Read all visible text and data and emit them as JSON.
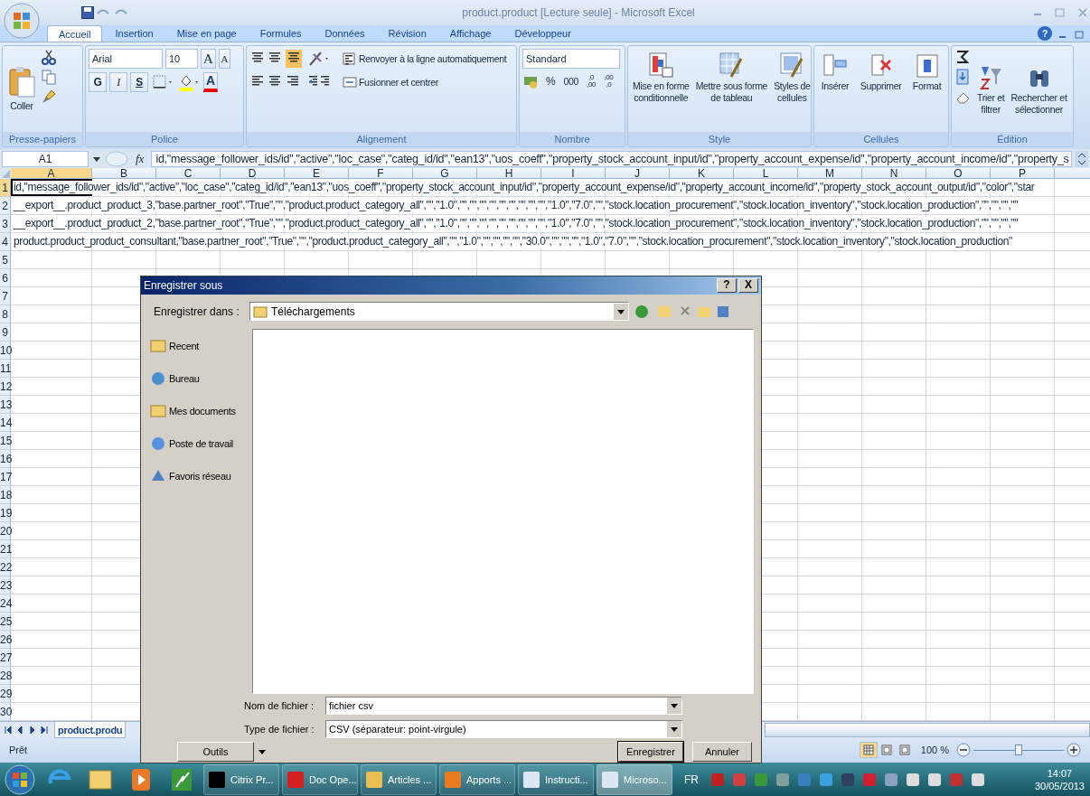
{
  "window": {
    "title": "product.product  [Lecture seule] - Microsoft Excel"
  },
  "ribbon_tabs": [
    {
      "label": "Accueil",
      "selected": true
    },
    {
      "label": "Insertion",
      "selected": false
    },
    {
      "label": "Mise en page",
      "selected": false
    },
    {
      "label": "Formules",
      "selected": false
    },
    {
      "label": "Données",
      "selected": false
    },
    {
      "label": "Révision",
      "selected": false
    },
    {
      "label": "Affichage",
      "selected": false
    },
    {
      "label": "Développeur",
      "selected": false
    }
  ],
  "ribbon": {
    "help": "?",
    "paste": "Coller",
    "font_name": "Arial",
    "font_size": "10",
    "grow": "A",
    "shrink": "A",
    "bold": "G",
    "italic": "I",
    "underline": "S",
    "font_color": "A",
    "wrap": "Renvoyer à la ligne automatiquement",
    "merge": "Fusionner et centrer",
    "number_format": "Standard",
    "percent": "%",
    "thousands": "000",
    "decimals": [
      {
        "top": ",0",
        "bottom": ",00"
      },
      {
        "top": ",00",
        "bottom": ",0"
      }
    ],
    "style_buttons": [
      {
        "lines": [
          "Mise en forme",
          "conditionnelle"
        ]
      },
      {
        "lines": [
          "Mettre sous forme",
          "de tableau"
        ]
      },
      {
        "lines": [
          "Styles de",
          "cellules"
        ]
      }
    ],
    "cell_buttons": [
      {
        "lines": [
          "Insérer"
        ]
      },
      {
        "lines": [
          "Supprimer"
        ]
      },
      {
        "lines": [
          "Format"
        ]
      }
    ],
    "edit_buttons": [
      {
        "lines": [
          "Trier et",
          "filtrer"
        ]
      },
      {
        "lines": [
          "Rechercher et",
          "sélectionner"
        ]
      }
    ],
    "groups": [
      "Presse-papiers",
      "Police",
      "Alignement",
      "Nombre",
      "Style",
      "Cellules",
      "Édition"
    ]
  },
  "formula_bar": {
    "name_box": "A1",
    "fx": "fx",
    "formula": "id,\"message_follower_ids/id\",\"active\",\"loc_case\",\"categ_id/id\",\"ean13\",\"uos_coeff\",\"property_stock_account_input/id\",\"property_account_expense/id\",\"property_account_income/id\",\"property_s"
  },
  "columns": [
    {
      "label": "A",
      "selected": true
    },
    {
      "label": "B",
      "selected": false
    },
    {
      "label": "C",
      "selected": false
    },
    {
      "label": "D",
      "selected": false
    },
    {
      "label": "E",
      "selected": false
    },
    {
      "label": "F",
      "selected": false
    },
    {
      "label": "G",
      "selected": false
    },
    {
      "label": "H",
      "selected": false
    },
    {
      "label": "I",
      "selected": false
    },
    {
      "label": "J",
      "selected": false
    },
    {
      "label": "K",
      "selected": false
    },
    {
      "label": "L",
      "selected": false
    },
    {
      "label": "M",
      "selected": false
    },
    {
      "label": "N",
      "selected": false
    },
    {
      "label": "O",
      "selected": false
    },
    {
      "label": "P",
      "selected": false
    }
  ],
  "rows": [
    {
      "number": "1",
      "selected": true,
      "text": "id,\"message_follower_ids/id\",\"active\",\"loc_case\",\"categ_id/id\",\"ean13\",\"uos_coeff\",\"property_stock_account_input/id\",\"property_account_expense/id\",\"property_account_income/id\",\"property_stock_account_output/id\",\"color\",\"star"
    },
    {
      "number": "2",
      "selected": false,
      "text": "__export__.product_product_3,\"base.partner_root\",\"True\",\"\",\"product.product_category_all\",\"\",\"1.0\",\"\",\"\",\"\",\"\",\"\",\"\",\"\",\"\",\"\",\"1.0\",\"7.0\",\"\",\"stock.location_procurement\",\"stock.location_inventory\",\"stock.location_production\",\"\",\"\",\"\",\"\""
    },
    {
      "number": "3",
      "selected": false,
      "text": "__export__.product_product_2,\"base.partner_root\",\"True\",\"\",\"product.product_category_all\",\"\",\"1.0\",\"\",\"\",\"\",\"\",\"\",\"\",\"\",\"\",\"\",\"1.0\",\"7.0\",\"\",\"stock.location_procurement\",\"stock.location_inventory\",\"stock.location_production\",\"\",\"\",\"\",\"\""
    },
    {
      "number": "4",
      "selected": false,
      "text": "product.product_product_consultant,\"base.partner_root\",\"True\",\"\",\"product.product_category_all\",\"\",\"1.0\",\"\",\"\",\"\",\"\",\"30.0\",\"\",\"\",\"\",\"1.0\",\"7.0\",\"\",\"stock.location_procurement\",\"stock.location_inventory\",\"stock.location_production\""
    },
    {
      "number": "5",
      "selected": false
    },
    {
      "number": "6",
      "selected": false
    },
    {
      "number": "7",
      "selected": false
    },
    {
      "number": "8",
      "selected": false
    },
    {
      "number": "9",
      "selected": false
    },
    {
      "number": "10",
      "selected": false
    },
    {
      "number": "11",
      "selected": false
    },
    {
      "number": "12",
      "selected": false
    },
    {
      "number": "13",
      "selected": false
    },
    {
      "number": "14",
      "selected": false
    },
    {
      "number": "15",
      "selected": false
    },
    {
      "number": "16",
      "selected": false
    },
    {
      "number": "17",
      "selected": false
    },
    {
      "number": "18",
      "selected": false
    },
    {
      "number": "19",
      "selected": false
    },
    {
      "number": "20",
      "selected": false
    },
    {
      "number": "21",
      "selected": false
    },
    {
      "number": "22",
      "selected": false
    },
    {
      "number": "23",
      "selected": false
    },
    {
      "number": "24",
      "selected": false
    },
    {
      "number": "25",
      "selected": false
    },
    {
      "number": "26",
      "selected": false
    },
    {
      "number": "27",
      "selected": false
    },
    {
      "number": "28",
      "selected": false
    },
    {
      "number": "29",
      "selected": false
    },
    {
      "number": "30",
      "selected": false
    }
  ],
  "sheet_tabs": [
    {
      "label": "product.produ",
      "selected": true
    }
  ],
  "status_bar": {
    "text": "Prêt",
    "views": [
      {
        "selected": true
      },
      {
        "selected": false
      },
      {
        "selected": false
      }
    ],
    "zoom": "100 %",
    "zoom_slider": {
      "level": 0.5
    }
  },
  "dialog": {
    "title": "Enregistrer sous",
    "help": "?",
    "close": "X",
    "save_in_label": "Enregistrer dans :",
    "save_in": "Téléchargements",
    "places": [
      "Recent",
      "Bureau",
      "Mes documents",
      "Poste de travail",
      "Favoris réseau"
    ],
    "filename_label": "Nom de fichier :",
    "filename": "fichier csv",
    "type_label": "Type de fichier :",
    "type": "CSV (séparateur: point-virgule)",
    "tools": "Outils",
    "save": "Enregistrer",
    "cancel": "Annuler"
  },
  "taskbar": {
    "items": [
      {
        "kind": "pinned",
        "selected": false
      },
      {
        "kind": "pinned",
        "selected": false
      },
      {
        "kind": "pinned",
        "selected": false
      },
      {
        "kind": "pinned",
        "selected": false
      },
      {
        "kind": "window",
        "label": "Citrix Pr...",
        "selected": false
      },
      {
        "kind": "window",
        "label": "Doc Ope...",
        "selected": false
      },
      {
        "kind": "window",
        "label": "Articles ...",
        "selected": false
      },
      {
        "kind": "window",
        "label": "Apports ...",
        "selected": false
      },
      {
        "kind": "window",
        "label": "Instructi...",
        "selected": false
      },
      {
        "kind": "window",
        "label": "Microso...",
        "selected": true
      }
    ],
    "language": "FR",
    "time": "14:07",
    "date": "30/05/2013"
  }
}
